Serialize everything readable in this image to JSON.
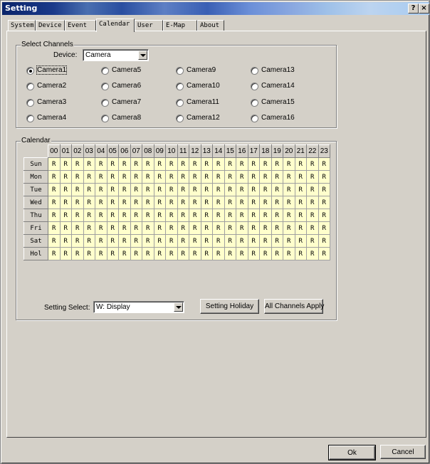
{
  "window": {
    "title": "Setting",
    "help_label": "?",
    "close_label": "×"
  },
  "tabs": [
    "System",
    "Device",
    "Event",
    "Calendar",
    "User",
    "E-Map",
    "About"
  ],
  "active_tab": "Calendar",
  "select_channels": {
    "legend": "Select Channels",
    "device_label": "Device:",
    "device_value": "Camera",
    "selected": "Camera1",
    "cameras": [
      [
        "Camera1",
        "Camera5",
        "Camera9",
        "Camera13"
      ],
      [
        "Camera2",
        "Camera6",
        "Camera10",
        "Camera14"
      ],
      [
        "Camera3",
        "Camera7",
        "Camera11",
        "Camera15"
      ],
      [
        "Camera4",
        "Camera8",
        "Camera12",
        "Camera16"
      ]
    ]
  },
  "calendar": {
    "legend": "Calendar",
    "hours": [
      "00",
      "01",
      "02",
      "03",
      "04",
      "05",
      "06",
      "07",
      "08",
      "09",
      "10",
      "11",
      "12",
      "13",
      "14",
      "15",
      "16",
      "17",
      "18",
      "19",
      "20",
      "21",
      "22",
      "23"
    ],
    "days": [
      "Sun",
      "Mon",
      "Tue",
      "Wed",
      "Thu",
      "Fri",
      "Sat",
      "Hol"
    ],
    "cell_value": "R",
    "cell_color": "#ffffcc"
  },
  "setting_select": {
    "label": "Setting Select:",
    "value": "W: Display"
  },
  "buttons": {
    "holiday": "Setting Holiday",
    "apply_all": "All Channels Apply",
    "ok": "Ok",
    "cancel": "Cancel"
  }
}
